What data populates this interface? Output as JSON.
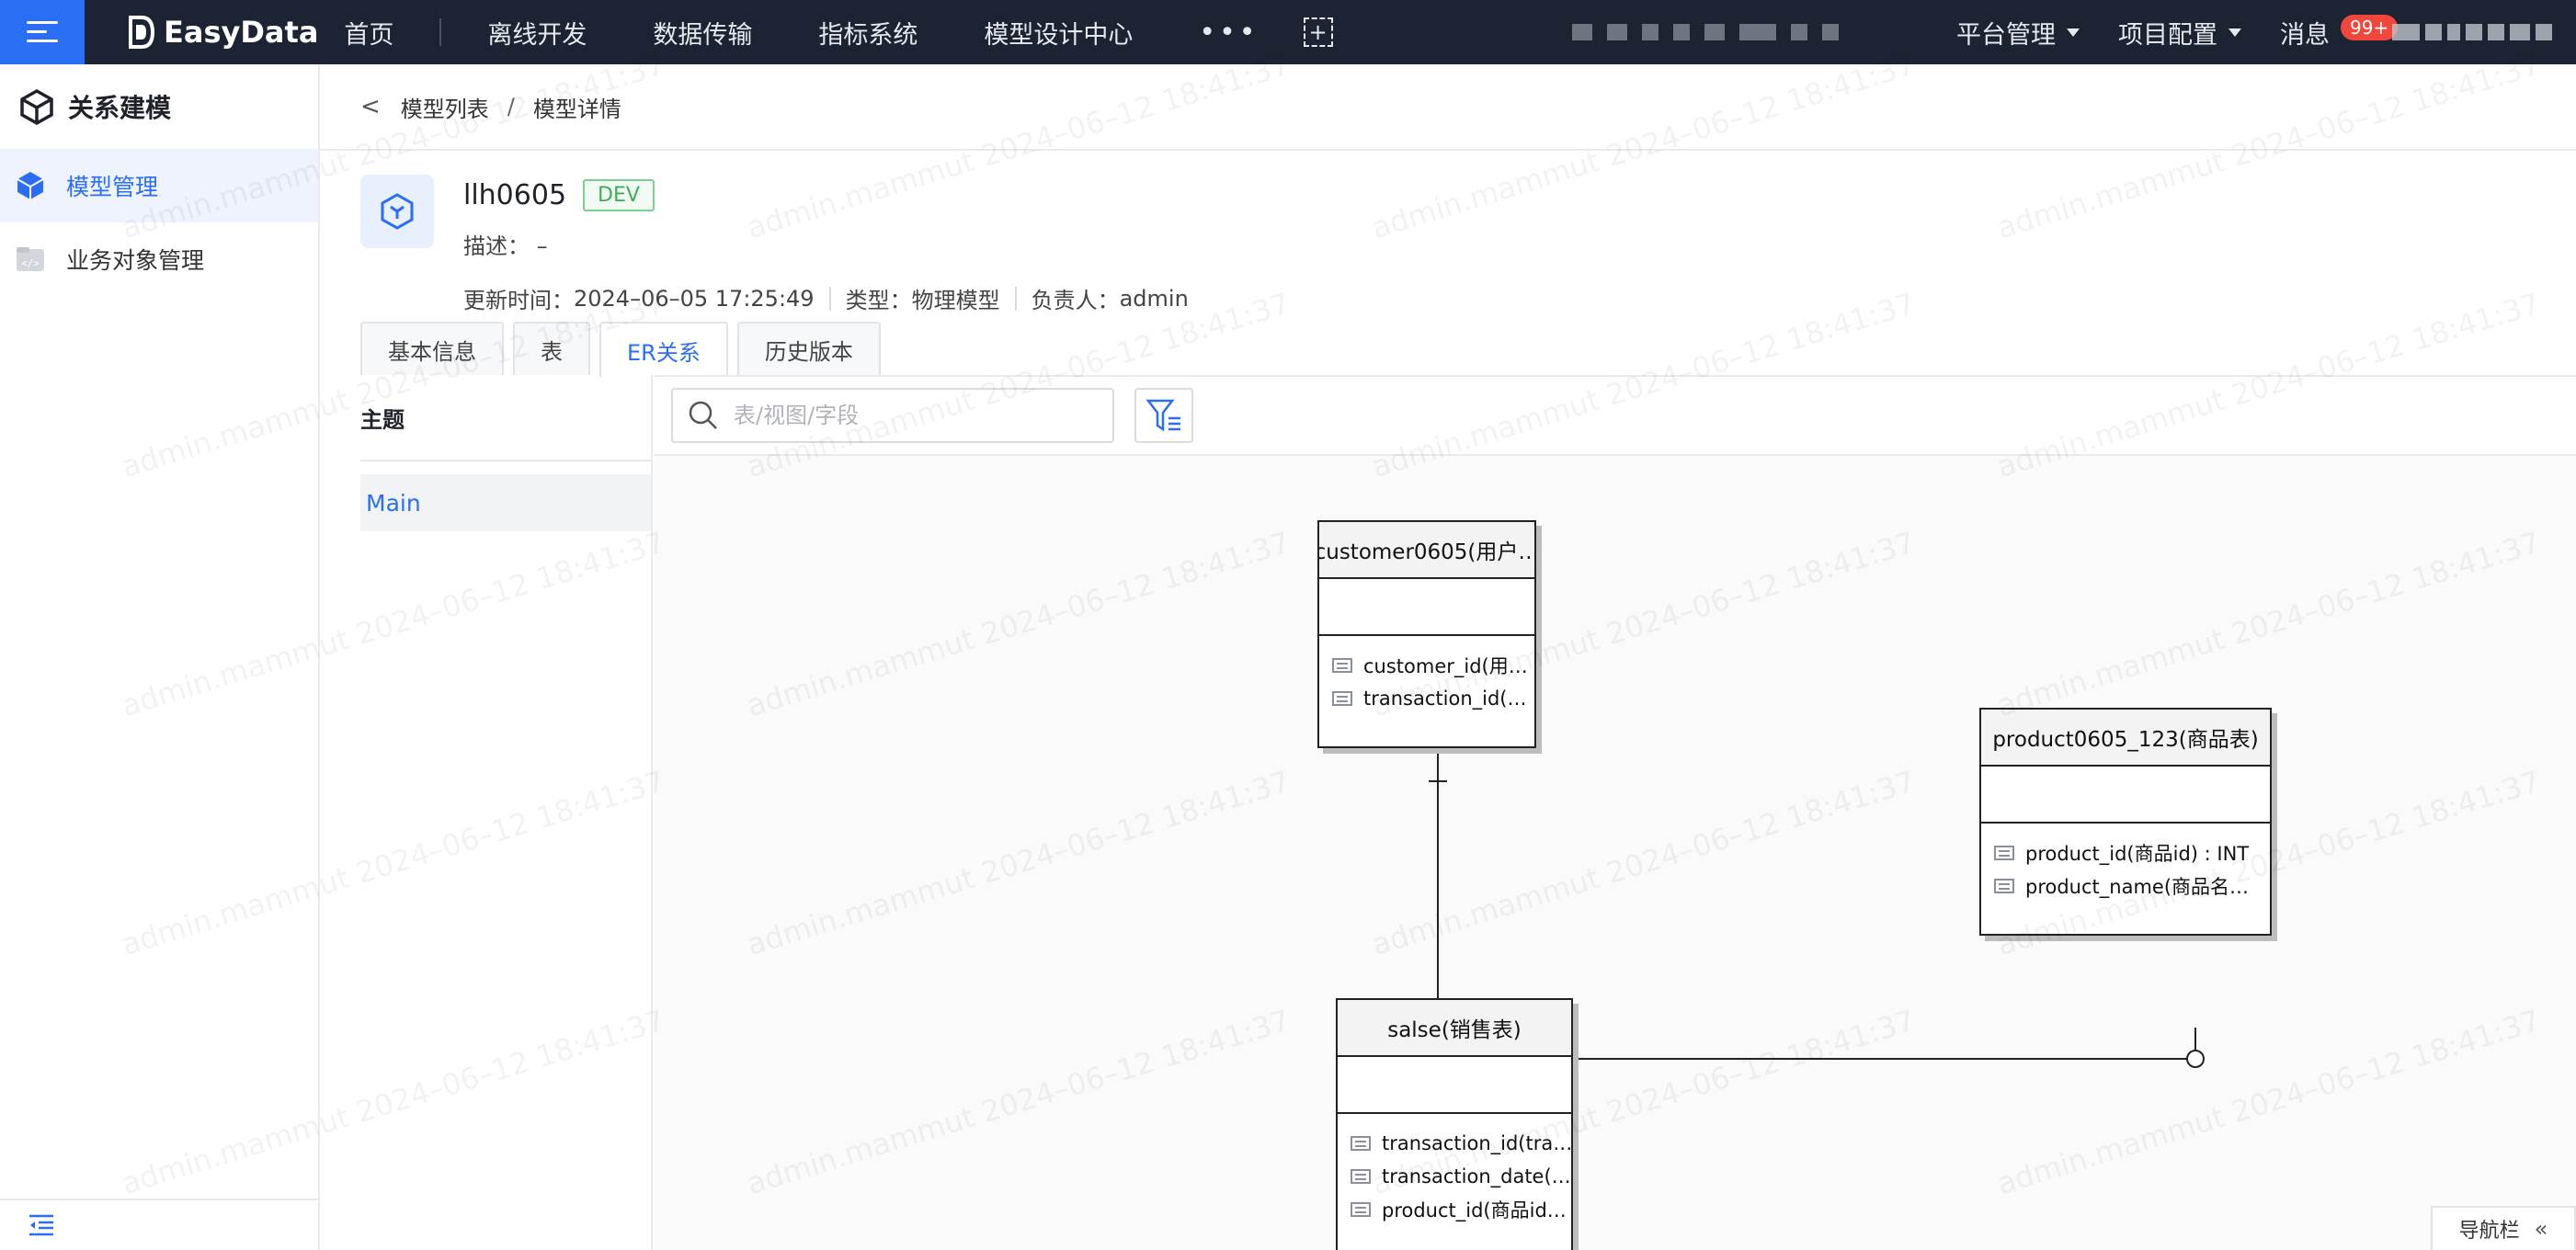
{
  "topbar": {
    "brand": "EasyData",
    "nav": [
      "首页",
      "离线开发",
      "数据传输",
      "指标系统",
      "模型设计中心"
    ],
    "more": "•••",
    "right": {
      "platform": "平台管理",
      "project": "项目配置",
      "messages": "消息",
      "badge": "99+"
    }
  },
  "sidebar": {
    "title": "关系建模",
    "items": [
      {
        "label": "模型管理",
        "active": true
      },
      {
        "label": "业务对象管理",
        "active": false
      }
    ]
  },
  "breadcrumb": {
    "parent": "模型列表",
    "separator": "/",
    "current": "模型详情"
  },
  "model": {
    "name": "llh0605",
    "env": "DEV",
    "desc_label": "描述：",
    "desc_value": "–",
    "updated_label": "更新时间：",
    "updated_value": "2024–06–05 17:25:49",
    "type_label": "类型：",
    "type_value": "物理模型",
    "owner_label": "负责人：",
    "owner_value": "admin"
  },
  "tabs": [
    {
      "label": "基本信息",
      "active": false
    },
    {
      "label": "表",
      "active": false
    },
    {
      "label": "ER关系",
      "active": true
    },
    {
      "label": "历史版本",
      "active": false
    }
  ],
  "theme_panel": {
    "title": "主题",
    "items": [
      "Main"
    ]
  },
  "search": {
    "placeholder": "表/视图/字段"
  },
  "er": {
    "entities": [
      {
        "key": "customer",
        "title": "customer0605(用户…",
        "fields": [
          "customer_id(用…",
          "transaction_id(…"
        ]
      },
      {
        "key": "product",
        "title": "product0605_123(商品表)",
        "fields": [
          "product_id(商品id) : INT",
          "product_name(商品名…"
        ]
      },
      {
        "key": "salse",
        "title": "salse(销售表)",
        "fields": [
          "transaction_id(tra…",
          "transaction_date(…",
          "product_id(商品id…"
        ]
      }
    ]
  },
  "navbar_button": "导航栏",
  "watermark": "admin.mammut 2024–06–12 18:41:37",
  "colors": {
    "primary": "#2a6ef5",
    "topbar": "#1c2433",
    "dev_tag": "#3fae59",
    "badge": "#f0463c"
  }
}
